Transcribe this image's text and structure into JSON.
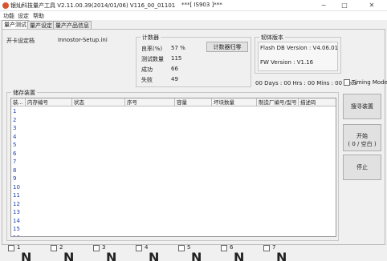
{
  "window": {
    "title": "银灿科技量产工具 V2.11.00.39(2014/01/06)   V116_00_01101",
    "center_title": "***[ IS903 ]***",
    "minimize": "−",
    "maximize": "□",
    "close": "✕"
  },
  "menu": [
    "功能",
    "设定",
    "帮助"
  ],
  "tabs": [
    "量产测试",
    "量产设定",
    "量产产品信息"
  ],
  "settings": {
    "label": "开卡设定档",
    "value": "Innostor-Setup.ini"
  },
  "counter": {
    "title": "计数器",
    "rows": [
      {
        "label": "良率(%)",
        "value": "57 %"
      },
      {
        "label": "测试数量",
        "value": "115"
      },
      {
        "label": "成功",
        "value": "66"
      },
      {
        "label": "失败",
        "value": "49"
      }
    ],
    "reset_button": "计数器归零"
  },
  "firmware": {
    "title": "韧体版本",
    "flash_db": "Flash DB Version :  V4.06.01",
    "fw": "FW Version :   V1.16"
  },
  "timer": {
    "text": "00 Days : 00 Hrs : 00 Mins : 00 Secs",
    "timing_mode_label": "Timing Mode",
    "timing_mode_checked": false
  },
  "devices": {
    "title": "储存装置",
    "columns": [
      "装...",
      "内存编号",
      "状态",
      "序号",
      "容量",
      "坏块数量",
      "制造厂编号/型号",
      "描述码"
    ],
    "rows": [
      "1",
      "2",
      "3",
      "4",
      "5",
      "6",
      "7",
      "8",
      "9",
      "10",
      "11",
      "12",
      "13",
      "14",
      "15",
      "16"
    ]
  },
  "buttons": {
    "scan": "搜寻装置",
    "start_line1": "开始",
    "start_line2": "( 0 / 空白 )",
    "stop": "停止"
  },
  "ports": {
    "labels": [
      "1",
      "2",
      "3",
      "4",
      "5",
      "6",
      "7"
    ],
    "status": [
      "N",
      "N",
      "N",
      "N",
      "N",
      "N",
      "N"
    ]
  }
}
